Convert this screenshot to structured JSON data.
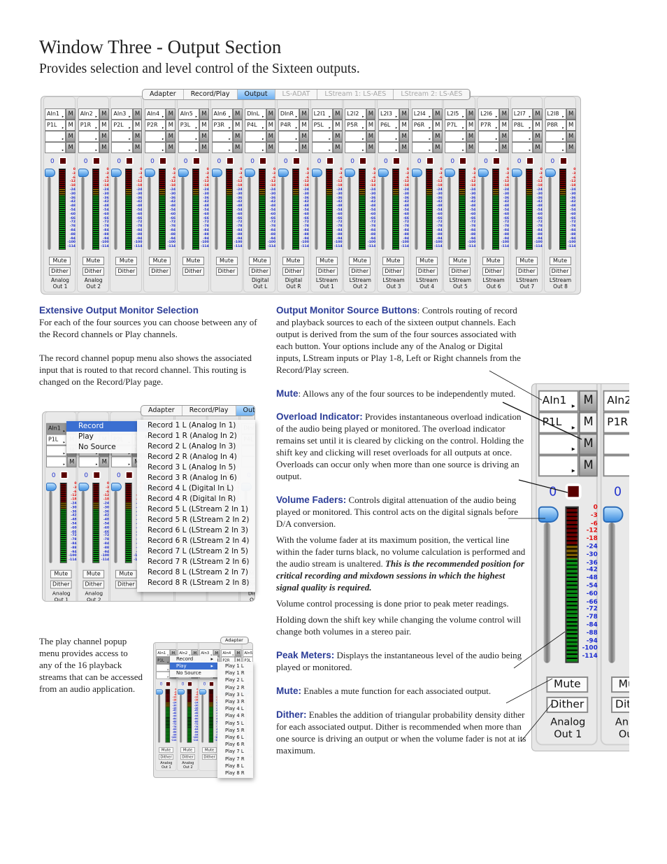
{
  "page": {
    "title": "Window Three - Output Section",
    "subtitle": "Provides selection and level control of the Sixteen outputs."
  },
  "tabs": [
    "Adapter",
    "Record/Play",
    "Output",
    "LS-ADAT",
    "LStream 1: LS-AES",
    "LStream 2: LS-AES"
  ],
  "active_tab": "Output",
  "colors": {
    "heading": "#2b3c97",
    "overload": "#5a0000",
    "tab_active": "#6fb0f0",
    "gain": "#2233cc"
  },
  "mixer": {
    "mute_glyph": "M",
    "arrow_glyph": "▸",
    "gain": "0",
    "mute": "Mute",
    "dither": "Dither",
    "meter_scale": [
      "0",
      "-3",
      "-6",
      "-12",
      "-18",
      "-24",
      "-30",
      "-36",
      "-42",
      "-48",
      "-54",
      "-60",
      "-66",
      "-72",
      "-78",
      "-84",
      "-88",
      "-94",
      "-100",
      "-114"
    ],
    "strips": [
      {
        "src": [
          "AIn1",
          "P1L",
          "",
          ""
        ],
        "label": [
          "Analog",
          "Out 1"
        ]
      },
      {
        "src": [
          "AIn2",
          "P1R",
          "",
          ""
        ],
        "label": [
          "Analog",
          "Out 2"
        ]
      },
      {
        "src": [
          "AIn3",
          "P2L",
          "",
          ""
        ],
        "label": [
          "",
          ""
        ]
      },
      {
        "src": [
          "AIn4",
          "P2R",
          "",
          ""
        ],
        "label": [
          "",
          ""
        ]
      },
      {
        "src": [
          "AIn5",
          "P3L",
          "",
          ""
        ],
        "label": [
          "",
          ""
        ]
      },
      {
        "src": [
          "AIn6",
          "P3R",
          "",
          ""
        ],
        "label": [
          "",
          ""
        ]
      },
      {
        "src": [
          "DInL",
          "P4L",
          "",
          ""
        ],
        "label": [
          "Digital",
          "Out L"
        ]
      },
      {
        "src": [
          "DInR",
          "P4R",
          "",
          ""
        ],
        "label": [
          "Digital",
          "Out R"
        ]
      },
      {
        "src": [
          "L2I1",
          "P5L",
          "",
          ""
        ],
        "label": [
          "LStream",
          "Out 1"
        ]
      },
      {
        "src": [
          "L2I2",
          "P5R",
          "",
          ""
        ],
        "label": [
          "LStream",
          "Out 2"
        ]
      },
      {
        "src": [
          "L2I3",
          "P6L",
          "",
          ""
        ],
        "label": [
          "LStream",
          "Out 3"
        ]
      },
      {
        "src": [
          "L2I4",
          "P6R",
          "",
          ""
        ],
        "label": [
          "LStream",
          "Out 4"
        ]
      },
      {
        "src": [
          "L2I5",
          "P7L",
          "",
          ""
        ],
        "label": [
          "LStream",
          "Out 5"
        ]
      },
      {
        "src": [
          "L2I6",
          "P7R",
          "",
          ""
        ],
        "label": [
          "LStream",
          "Out 6"
        ]
      },
      {
        "src": [
          "L2I7",
          "P8L",
          "",
          ""
        ],
        "label": [
          "LStream",
          "Out 7"
        ]
      },
      {
        "src": [
          "L2I8",
          "P8R",
          "",
          ""
        ],
        "label": [
          "LStream",
          "Out 8"
        ]
      }
    ]
  },
  "source_menu": [
    "Record",
    "Play",
    "No Source"
  ],
  "record_menu": [
    "Record 1 L (Analog In 1)",
    "Record 1 R (Analog In 2)",
    "Record 2 L (Analog In 3)",
    "Record 2 R (Analog In 4)",
    "Record 3 L (Analog In 5)",
    "Record 3 R (Analog In 6)",
    "Record 4 L (Digital In L)",
    "Record 4 R (Digital In R)",
    "Record 5 L (LStream 2 In 1)",
    "Record 5 R (LStream 2 In 2)",
    "Record 6 L (LStream 2 In 3)",
    "Record 6 R (LStream 2 In 4)",
    "Record 7 L (LStream 2 In 5)",
    "Record 7 R (LStream 2 In 6)",
    "Record 8 L (LStream 2 In 7)",
    "Record 8 R (LStream 2 In 8)"
  ],
  "play_menu": [
    "Play 1 L",
    "Play 1 R",
    "Play 2 L",
    "Play 2 R",
    "Play 3 L",
    "Play 3 R",
    "Play 4 L",
    "Play 4 R",
    "Play 5 L",
    "Play 5 R",
    "Play 6 L",
    "Play 6 R",
    "Play 7 L",
    "Play 7 R",
    "Play 8 L",
    "Play 8 R"
  ],
  "left": {
    "heading": "Extensive Output Monitor Selection",
    "p1": "For each of the four sources you can choose between any of the Record channels or Play channels.",
    "p2": "The record channel popup menu also shows the associated input that is routed to that record channel. This routing is changed on the Record/Play page.",
    "p3": "The play channel popup menu provides access to any of the 16 playback streams that can be accessed from an audio application."
  },
  "right": {
    "src_h": "Output Monitor Source Buttons",
    "src_t": ": Controls routing of record and playback sources to each of the sixteen output channels. Each output is derived from the sum of the four sources associated with each button. Your options include any of the Analog or Digital inputs, LStream inputs or Play 1-8, Left or Right channels from the Record/Play screen.",
    "mute_h": "Mute",
    "mute_t": ": Allows any of the four sources to be independently muted.",
    "ovl_h": "Overload Indicator:",
    "ovl_t": " Provides instantaneous overload indication of the audio being played or monitored. The overload indicator remains set until it is cleared by clicking on the control.  Holding the shift key and clicking will reset overloads for all outputs at once. Overloads can occur only when more than one source is driving an output.",
    "vol_h": "Volume Faders:",
    "vol_t": " Controls digital attenuation of the audio being played or monitored. This control acts on the digital signals before D/A conversion.",
    "vol_p2": "With the volume fader at its maximum position, the vertical line within the fader turns black, no volume calculation is performed and the audio stream is unaltered. ",
    "vol_p2_bi": "This is the recommended position for critical recording and mixdown sessions in which the highest signal quality is required.",
    "vol_p3": "Volume control processing is done prior to peak meter readings.",
    "vol_p4": "Holding down the shift key while changing the volume control will change both volumes in a stereo pair.",
    "peak_h": "Peak Meters:",
    "peak_t": " Displays the instantaneous level of the audio being played or monitored.",
    "mute2_h": "Mute:",
    "mute2_t": " Enables a mute function for each associated output.",
    "dith_h": "Dither:",
    "dith_t": " Enables the addition of triangular probability density dither for each associated output. Dither is recommended when more than one source is driving an output or when the volume fader is not at its maximum."
  }
}
